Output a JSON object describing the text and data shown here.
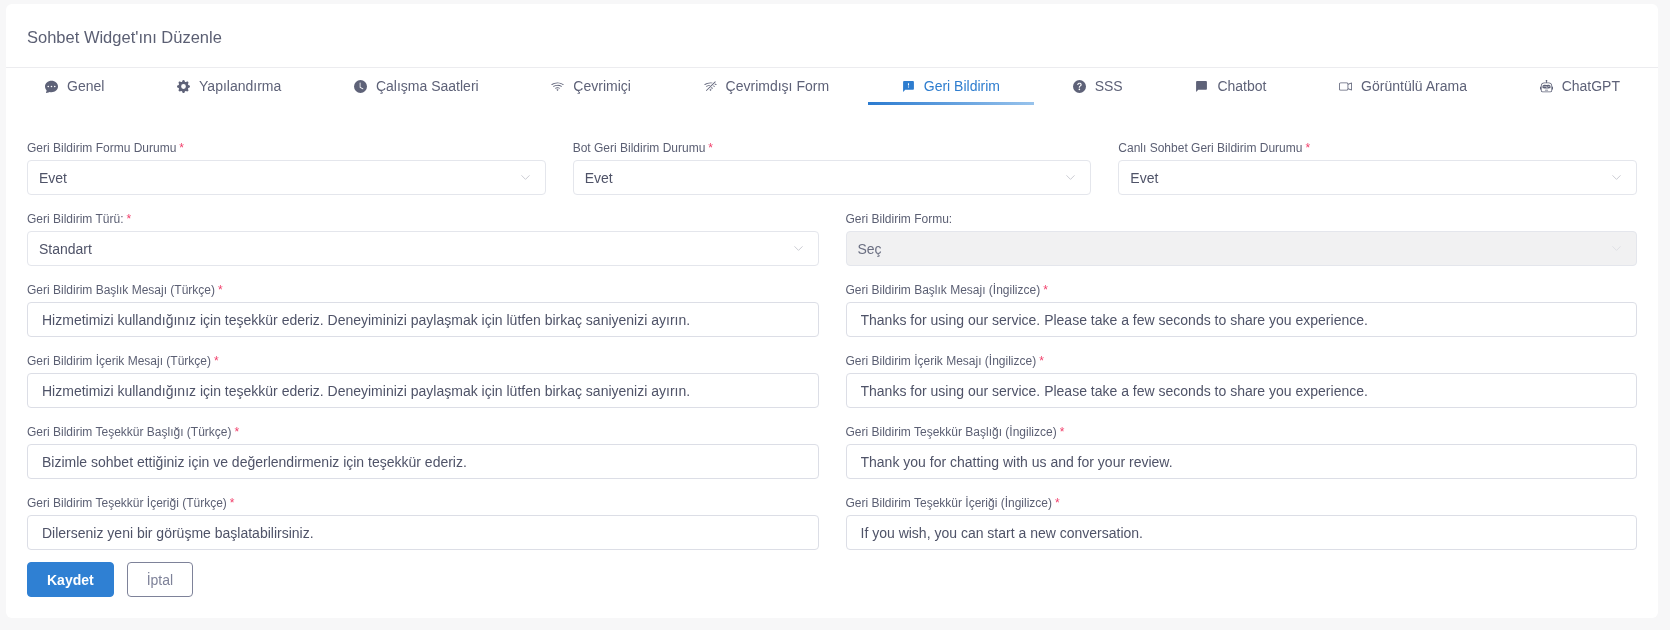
{
  "page": {
    "title": "Sohbet Widget'ını Düzenle"
  },
  "tabs": [
    {
      "label": "Genel",
      "selected": false
    },
    {
      "label": "Yapılandırma",
      "selected": false
    },
    {
      "label": "Çalışma Saatleri",
      "selected": false
    },
    {
      "label": "Çevrimiçi",
      "selected": false
    },
    {
      "label": "Çevrimdışı Form",
      "selected": false
    },
    {
      "label": "Geri Bildirim",
      "selected": true
    },
    {
      "label": "SSS",
      "selected": false
    },
    {
      "label": "Chatbot",
      "selected": false
    },
    {
      "label": "Görüntülü Arama",
      "selected": false
    },
    {
      "label": "ChatGPT",
      "selected": false
    }
  ],
  "form": {
    "rows": [
      {
        "fields": [
          {
            "kind": "select",
            "label": "Geri Bildirim Formu Durumu",
            "required_mark": "*",
            "value": "Evet",
            "disabled": false
          },
          {
            "kind": "select",
            "label": "Bot Geri Bildirim Durumu",
            "required_mark": "*",
            "value": "Evet",
            "disabled": false
          },
          {
            "kind": "select",
            "label": "Canlı Sohbet Geri Bildirim Durumu",
            "required_mark": "*",
            "value": "Evet",
            "disabled": false
          }
        ]
      },
      {
        "fields": [
          {
            "kind": "select",
            "label": "Geri Bildirim Türü:",
            "required_mark": "*",
            "value": "Standart",
            "disabled": false
          },
          {
            "kind": "select",
            "label": "Geri Bildirim Formu:",
            "value": "Seç",
            "disabled": true
          }
        ]
      },
      {
        "fields": [
          {
            "kind": "text",
            "label": "Geri Bildirim Başlık Mesajı (Türkçe)",
            "required_mark": "*",
            "value": "Hizmetimizi kullandığınız için teşekkür ederiz. Deneyiminizi paylaşmak için lütfen birkaç saniyenizi ayırın.",
            "disabled": false
          },
          {
            "kind": "text",
            "label": "Geri Bildirim Başlık Mesajı (İngilizce)",
            "required_mark": "*",
            "value": "Thanks for using our service. Please take a few seconds to share you experience.",
            "disabled": false
          }
        ]
      },
      {
        "fields": [
          {
            "kind": "text",
            "label": "Geri Bildirim İçerik Mesajı (Türkçe)",
            "required_mark": "*",
            "value": "Hizmetimizi kullandığınız için teşekkür ederiz. Deneyiminizi paylaşmak için lütfen birkaç saniyenizi ayırın.",
            "disabled": false
          },
          {
            "kind": "text",
            "label": "Geri Bildirim İçerik Mesajı (İngilizce)",
            "required_mark": "*",
            "value": "Thanks for using our service. Please take a few seconds to share you experience.",
            "disabled": false
          }
        ]
      },
      {
        "fields": [
          {
            "kind": "text",
            "label": "Geri Bildirim Teşekkür Başlığı (Türkçe)",
            "required_mark": "*",
            "value": "Bizimle sohbet ettiğiniz için ve değerlendirmeniz için teşekkür ederiz.",
            "disabled": false
          },
          {
            "kind": "text",
            "label": "Geri Bildirim Teşekkür Başlığı (İngilizce)",
            "required_mark": "*",
            "value": "Thank you for chatting with us and for your review.",
            "disabled": false
          }
        ]
      },
      {
        "fields": [
          {
            "kind": "text",
            "label": "Geri Bildirim Teşekkür İçeriği (Türkçe)",
            "required_mark": "*",
            "value": "Dilerseniz yeni bir görüşme başlatabilirsiniz.",
            "disabled": false
          },
          {
            "kind": "text",
            "label": "Geri Bildirim Teşekkür İçeriği (İngilizce)",
            "required_mark": "*",
            "value": "If you wish, you can start a new conversation.",
            "disabled": false
          }
        ]
      }
    ]
  },
  "buttons": [
    {
      "kind": "primary",
      "label": "Kaydet"
    },
    {
      "kind": "secondary",
      "label": "İptal"
    }
  ]
}
